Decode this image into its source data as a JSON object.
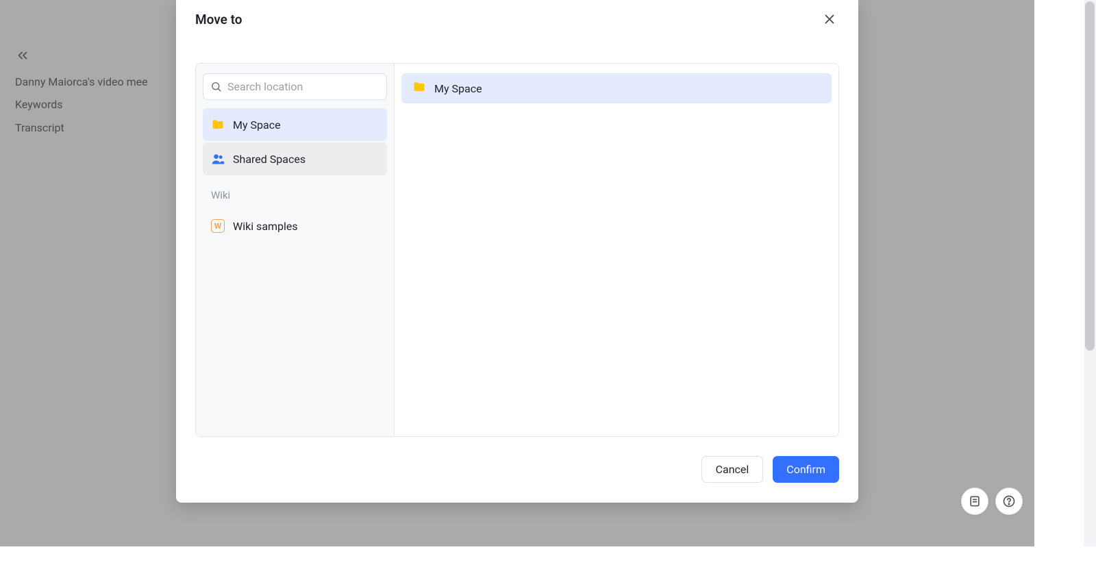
{
  "background": {
    "doc_title": "Danny Maiorca's video mee",
    "nav_items": [
      "Keywords",
      "Transcript"
    ]
  },
  "modal": {
    "title": "Move to",
    "search_placeholder": "Search location",
    "left": {
      "items": [
        {
          "icon": "folder",
          "label": "My Space",
          "state": "selected"
        },
        {
          "icon": "people",
          "label": "Shared Spaces",
          "state": "hover"
        }
      ],
      "section_label": "Wiki",
      "wiki_items": [
        {
          "icon": "wiki",
          "label": "Wiki samples"
        }
      ]
    },
    "right": {
      "breadcrumb": [
        {
          "icon": "folder",
          "label": "My Space"
        }
      ]
    },
    "buttons": {
      "cancel": "Cancel",
      "confirm": "Confirm"
    }
  },
  "wiki_badge_letter": "W"
}
